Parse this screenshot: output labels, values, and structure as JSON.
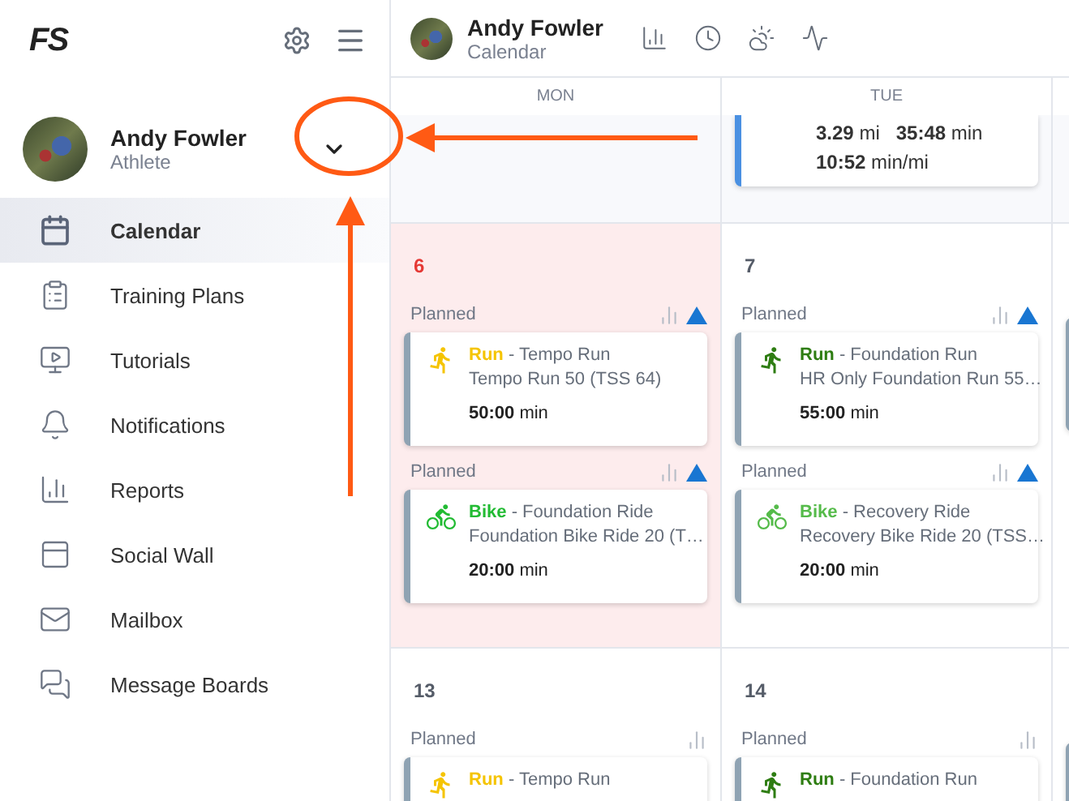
{
  "sidebar": {
    "logo": "FS",
    "user": {
      "name": "Andy Fowler",
      "role": "Athlete"
    },
    "nav": [
      {
        "label": "Calendar",
        "selected": true
      },
      {
        "label": "Training Plans",
        "selected": false
      },
      {
        "label": "Tutorials",
        "selected": false
      },
      {
        "label": "Notifications",
        "selected": false
      },
      {
        "label": "Reports",
        "selected": false
      },
      {
        "label": "Social Wall",
        "selected": false
      },
      {
        "label": "Mailbox",
        "selected": false
      },
      {
        "label": "Message Boards",
        "selected": false
      }
    ]
  },
  "header": {
    "name": "Andy Fowler",
    "subtitle": "Calendar"
  },
  "calendar": {
    "days": [
      "MON",
      "TUE"
    ],
    "weeks": [
      {
        "cells": [
          {
            "today": false
          },
          {
            "today": false,
            "completed": {
              "color": "#4a90e2",
              "lines": [
                "**3.29** mi   **35:48** min",
                "**10:52** min/mi"
              ]
            }
          }
        ]
      },
      {
        "cells": [
          {
            "date": "6",
            "today": true,
            "workouts": [
              {
                "status": "Planned",
                "marked": true,
                "kind": "run",
                "sport": "Run",
                "color": "#f5c400",
                "title": "- Tempo Run",
                "detail": "Tempo Run 50 (TSS 64)",
                "duration": "**50:00** min"
              },
              {
                "status": "Planned",
                "marked": true,
                "kind": "bike",
                "sport": "Bike",
                "color": "#22bb33",
                "title": "- Foundation Ride",
                "detail": "Foundation Bike Ride 20 (T…",
                "duration": "**20:00** min"
              }
            ]
          },
          {
            "date": "7",
            "today": false,
            "workouts": [
              {
                "status": "Planned",
                "marked": true,
                "kind": "run",
                "sport": "Run",
                "color": "#2e7d12",
                "title": "- Foundation Run",
                "detail": "HR Only Foundation Run 55…",
                "duration": "**55:00** min"
              },
              {
                "status": "Planned",
                "marked": true,
                "kind": "bike",
                "sport": "Bike",
                "color": "#55bb4a",
                "title": "- Recovery Ride",
                "detail": "Recovery Bike Ride 20 (TSS…",
                "duration": "**20:00** min"
              }
            ]
          }
        ]
      },
      {
        "cells": [
          {
            "date": "13",
            "today": false,
            "workouts": [
              {
                "status": "Planned",
                "marked": false,
                "kind": "run",
                "sport": "Run",
                "color": "#f5c400",
                "title": "- Tempo Run"
              }
            ]
          },
          {
            "date": "14",
            "today": false,
            "workouts": [
              {
                "status": "Planned",
                "marked": false,
                "kind": "run",
                "sport": "Run",
                "color": "#2e7d12",
                "title": "- Foundation Run"
              }
            ]
          }
        ]
      }
    ]
  }
}
